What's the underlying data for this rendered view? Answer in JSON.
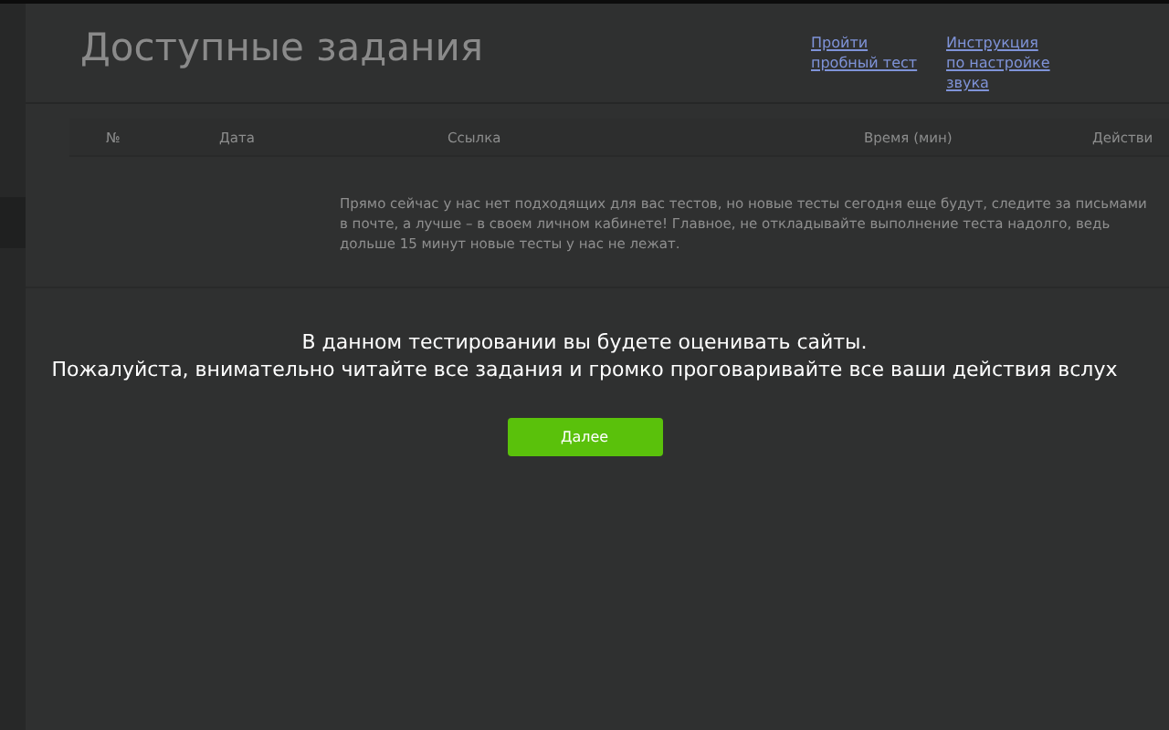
{
  "page": {
    "title": "Доступные задания",
    "links": [
      "Пройти пробный тест",
      "Инструкция по настройке звука"
    ],
    "table": {
      "columns": [
        "№",
        "Дата",
        "Ссылка",
        "Время (мин)",
        "Действи"
      ]
    },
    "empty_message": "Прямо сейчас у нас нет подходящих для вас тестов, но новые тесты сегодня еще будут, следите за письмами в почте, а лучше – в своем личном кабинете! Главное, не откладывайте выполнение теста надолго, ведь дольше 15 минут новые тесты у нас не лежат."
  },
  "dialog": {
    "lines": [
      "В данном тестировании вы будете оценивать сайты.",
      "Пожалуйста, внимательно читайте все задания и громко проговаривайте все ваши действия вслух"
    ],
    "button": "Далее"
  }
}
